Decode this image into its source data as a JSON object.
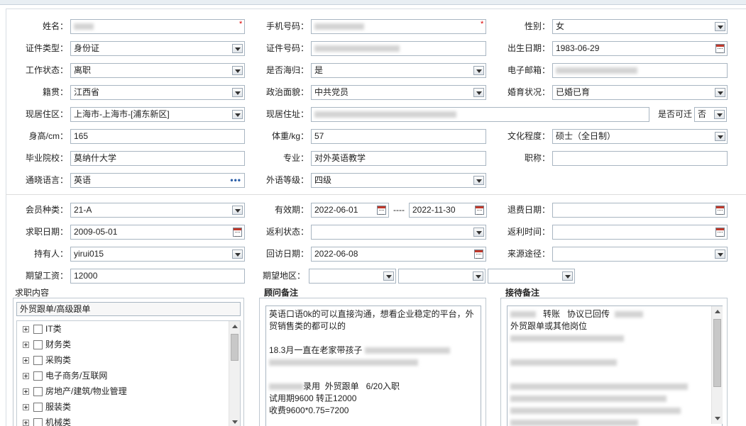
{
  "basic": {
    "name_label": "姓名：",
    "phone_label": "手机号码：",
    "gender_label": "性别：",
    "gender_value": "女",
    "idtype_label": "证件类型：",
    "idtype_value": "身份证",
    "idno_label": "证件号码：",
    "birth_label": "出生日期：",
    "birth_value": "1983-06-29",
    "workstatus_label": "工作状态：",
    "workstatus_value": "离职",
    "returnee_label": "是否海归：",
    "returnee_value": "是",
    "email_label": "电子邮箱：",
    "native_label": "籍贯：",
    "native_value": "江西省",
    "political_label": "政治面貌：",
    "political_value": "中共党员",
    "marital_label": "婚育状况：",
    "marital_value": "已婚已育",
    "residence_label": "现居住区：",
    "residence_value": "上海市-上海市-[浦东新区]",
    "address_label": "现居住址：",
    "relocate_label": "是否可迁",
    "relocate_value": "否",
    "height_label": "身高/cm：",
    "height_value": "165",
    "weight_label": "体重/kg：",
    "weight_value": "57",
    "education_label": "文化程度：",
    "education_value": "硕士（全日制）",
    "school_label": "毕业院校：",
    "school_value": "莫纳什大学",
    "major_label": "专业：",
    "major_value": "对外英语教学",
    "title_label": "职称：",
    "language_label": "通晓语言：",
    "language_value": "英语",
    "language_btn": "•••",
    "level_label": "外语等级：",
    "level_value": "四级"
  },
  "membership": {
    "type_label": "会员种类：",
    "type_value": "21-A",
    "valid_label": "有效期：",
    "valid_from": "2022-06-01",
    "valid_sep": "----",
    "valid_to": "2022-11-30",
    "refund_label": "退费日期：",
    "jobdate_label": "求职日期：",
    "jobdate_value": "2009-05-01",
    "rebate_label": "返利状态：",
    "rebatetime_label": "返利时间：",
    "holder_label": "持有人：",
    "holder_value": "yirui015",
    "visit_label": "回访日期：",
    "visit_value": "2022-06-08",
    "source_label": "来源途径：",
    "salary_label": "期望工资：",
    "salary_value": "12000",
    "region_label": "期望地区："
  },
  "job_panel": {
    "title": "求职内容",
    "selected": "外贸跟单/高级跟单",
    "items": [
      "IT类",
      "财务类",
      "采购类",
      "电子商务/互联网",
      "房地产/建筑/物业管理",
      "服装类",
      "机械类"
    ]
  },
  "consultant": {
    "title": "顾问备注",
    "line1": "英语口语0k的可以直接沟通，想看企业稳定的平台，外",
    "line2": "贸销售类的都可以的",
    "line3": "18.3月一直在老家带孩子",
    "line4": "录用  外贸跟单   6/20入职",
    "line5": "试用期9600 转正12000",
    "line6": "收费9600*0.75=7200"
  },
  "reception": {
    "title": "接待备注",
    "line1a": "转账",
    "line1b": "协议已回传",
    "line2": "外贸跟单或其他岗位"
  }
}
